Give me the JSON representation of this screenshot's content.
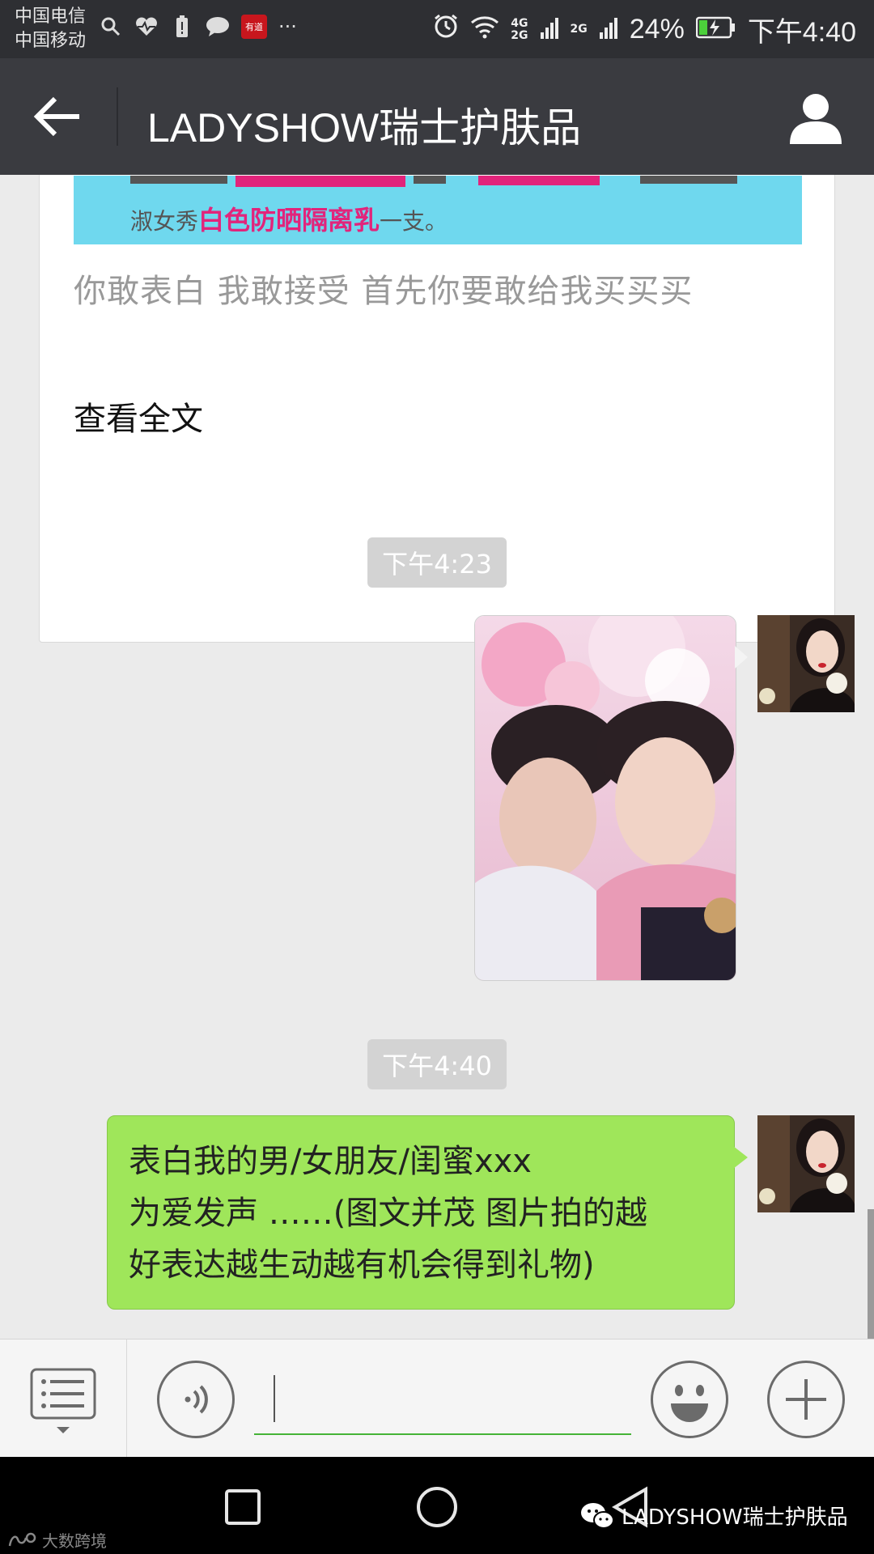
{
  "status_bar": {
    "carrier_1": "中国电信",
    "carrier_2": "中国移动",
    "notification_badge": "有道",
    "more": "···",
    "network_1_top": "4G",
    "network_1_bottom": "2G",
    "network_2": "2G",
    "battery_percent": "24%",
    "time": "下午4:40",
    "icons": [
      "search-icon",
      "heart-rate-icon",
      "battery-alert-icon",
      "chat-icon",
      "youdao-icon",
      "alarm-icon",
      "wifi-icon",
      "signal-icon",
      "signal-icon",
      "battery-charging-icon"
    ]
  },
  "title_bar": {
    "title": "LADYSHOW瑞士护肤品"
  },
  "article_card": {
    "banner_prefix": "淑女秀",
    "banner_highlight": "白色防晒隔离乳",
    "banner_suffix": "一支。",
    "summary": "你敢表白 我敢接受 首先你要敢给我买买买",
    "read_more": "查看全文"
  },
  "messages": [
    {
      "type": "timestamp",
      "text": "下午4:23"
    },
    {
      "type": "image",
      "from": "self"
    },
    {
      "type": "timestamp",
      "text": "下午4:40"
    },
    {
      "type": "text",
      "from": "self",
      "lines": [
        "表白我的男/女朋友/闺蜜xxx",
        "为爱发声 ……(图文并茂 图片拍的越",
        "好表达越生动越有机会得到礼物)"
      ]
    }
  ],
  "input_bar": {
    "value": "",
    "placeholder": ""
  },
  "watermark": {
    "left": "大数跨境",
    "right": "LADYSHOW瑞士护肤品"
  },
  "colors": {
    "status_bar_bg": "#2e2f33",
    "title_bar_bg": "#3a3b40",
    "chat_bg": "#ebebeb",
    "bubble_green": "#9fe65a",
    "input_underline": "#46b337",
    "banner_bg": "#6fd8ee",
    "banner_highlight": "#e2247b"
  }
}
